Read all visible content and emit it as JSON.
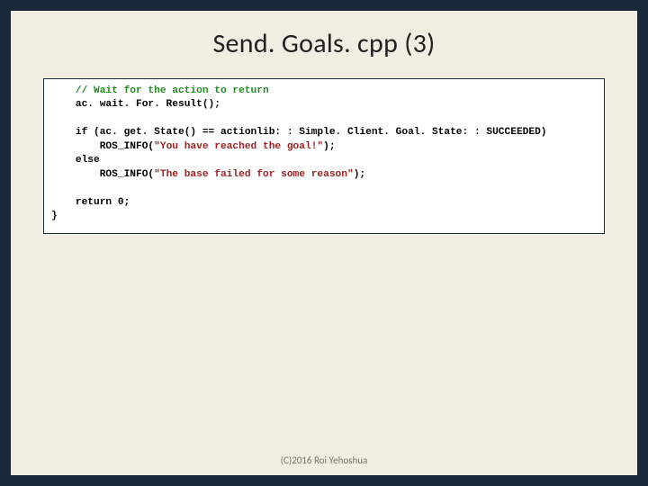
{
  "title": "Send. Goals. cpp (3)",
  "code": {
    "c1": "    // Wait for the action to return",
    "l2": "    ac. wait. For. Result();",
    "l3": " ",
    "l4a": "    if (ac. get. State() == actionlib: : Simple. Client. Goal. State: : SUCCEEDED)",
    "l5a": "        ROS_INFO(",
    "s5": "\"You have reached the goal!\"",
    "l5b": ");",
    "l6": "    else",
    "l7a": "        ROS_INFO(",
    "s7": "\"The base failed for some reason\"",
    "l7b": ");",
    "l8": " ",
    "l9": "    return 0;",
    "l10": "}"
  },
  "footer": "(C)2016 Roi Yehoshua"
}
